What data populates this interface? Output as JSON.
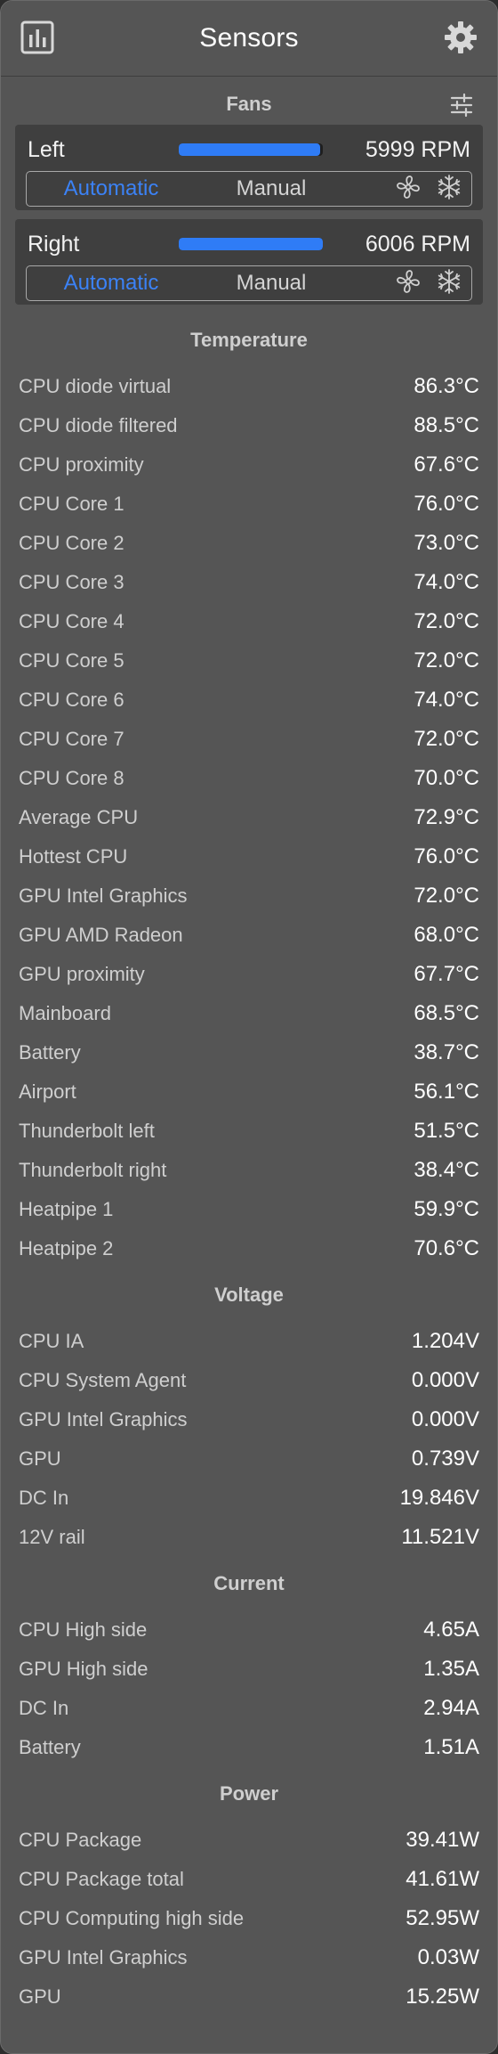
{
  "window": {
    "title": "Sensors"
  },
  "icons": {
    "chart": "bar-chart-icon",
    "settings": "gear-icon",
    "adjust": "sliders-icon",
    "fan": "fan-icon",
    "snow": "snowflake-icon"
  },
  "colors": {
    "accent": "#2f7cf6",
    "background": "#555555",
    "card": "#3f3f3f"
  },
  "fans": {
    "header": "Fans",
    "items": [
      {
        "name": "Left",
        "rpm": "5999 RPM",
        "level": 0.98,
        "auto_label": "Automatic",
        "manual_label": "Manual",
        "mode": "Automatic"
      },
      {
        "name": "Right",
        "rpm": "6006 RPM",
        "level": 1.0,
        "auto_label": "Automatic",
        "manual_label": "Manual",
        "mode": "Automatic"
      }
    ]
  },
  "sections": [
    {
      "header": "Temperature",
      "rows": [
        {
          "name": "CPU diode virtual",
          "value": "86.3°C"
        },
        {
          "name": "CPU diode filtered",
          "value": "88.5°C"
        },
        {
          "name": "CPU proximity",
          "value": "67.6°C"
        },
        {
          "name": "CPU Core 1",
          "value": "76.0°C"
        },
        {
          "name": "CPU Core 2",
          "value": "73.0°C"
        },
        {
          "name": "CPU Core 3",
          "value": "74.0°C"
        },
        {
          "name": "CPU Core 4",
          "value": "72.0°C"
        },
        {
          "name": "CPU Core 5",
          "value": "72.0°C"
        },
        {
          "name": "CPU Core 6",
          "value": "74.0°C"
        },
        {
          "name": "CPU Core 7",
          "value": "72.0°C"
        },
        {
          "name": "CPU Core 8",
          "value": "70.0°C"
        },
        {
          "name": "Average CPU",
          "value": "72.9°C"
        },
        {
          "name": "Hottest CPU",
          "value": "76.0°C"
        },
        {
          "name": "GPU Intel Graphics",
          "value": "72.0°C"
        },
        {
          "name": "GPU AMD Radeon",
          "value": "68.0°C"
        },
        {
          "name": "GPU proximity",
          "value": "67.7°C"
        },
        {
          "name": "Mainboard",
          "value": "68.5°C"
        },
        {
          "name": "Battery",
          "value": "38.7°C"
        },
        {
          "name": "Airport",
          "value": "56.1°C"
        },
        {
          "name": "Thunderbolt left",
          "value": "51.5°C"
        },
        {
          "name": "Thunderbolt right",
          "value": "38.4°C"
        },
        {
          "name": "Heatpipe 1",
          "value": "59.9°C"
        },
        {
          "name": "Heatpipe 2",
          "value": "70.6°C"
        }
      ]
    },
    {
      "header": "Voltage",
      "rows": [
        {
          "name": "CPU IA",
          "value": "1.204V"
        },
        {
          "name": "CPU System Agent",
          "value": "0.000V"
        },
        {
          "name": "GPU Intel Graphics",
          "value": "0.000V"
        },
        {
          "name": "GPU",
          "value": "0.739V"
        },
        {
          "name": "DC In",
          "value": "19.846V"
        },
        {
          "name": "12V rail",
          "value": "11.521V"
        }
      ]
    },
    {
      "header": "Current",
      "rows": [
        {
          "name": "CPU High side",
          "value": "4.65A"
        },
        {
          "name": "GPU High side",
          "value": "1.35A"
        },
        {
          "name": "DC In",
          "value": "2.94A"
        },
        {
          "name": "Battery",
          "value": "1.51A"
        }
      ]
    },
    {
      "header": "Power",
      "rows": [
        {
          "name": "CPU Package",
          "value": "39.41W"
        },
        {
          "name": "CPU Package total",
          "value": "41.61W"
        },
        {
          "name": "CPU Computing high side",
          "value": "52.95W"
        },
        {
          "name": "GPU Intel Graphics",
          "value": "0.03W"
        },
        {
          "name": "GPU",
          "value": "15.25W"
        }
      ]
    }
  ]
}
